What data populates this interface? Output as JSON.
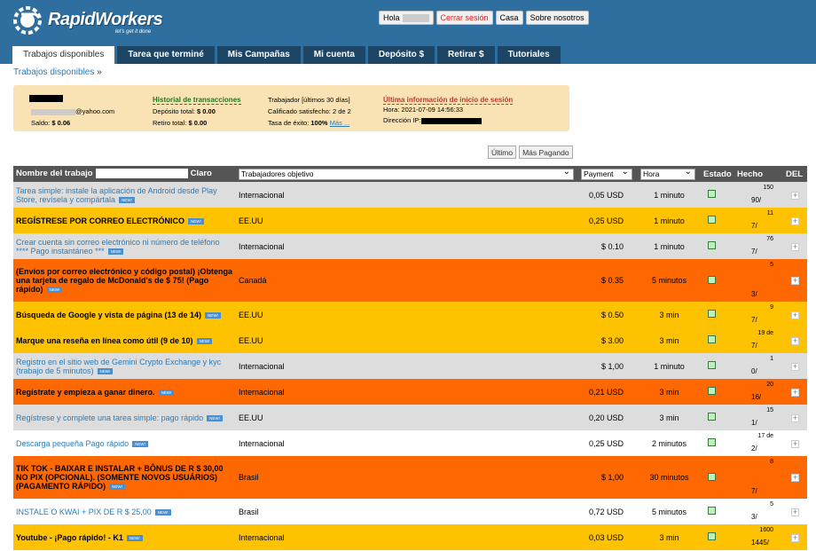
{
  "brand": {
    "name": "RapidWorkers",
    "tagline": "let's get it done"
  },
  "top": {
    "hello": "Hola",
    "logout": "Cerrar sesión",
    "home": "Casa",
    "about": "Sobre nosotros"
  },
  "tabs": [
    "Trabajos disponibles",
    "Tarea que terminé",
    "Mis Campañas",
    "Mi cuenta",
    "Depósito $",
    "Retirar $",
    "Tutoriales"
  ],
  "breadcrumb": {
    "label": "Trabajos disponibles",
    "arrow": "»"
  },
  "account": {
    "email_suffix": "@yahoo.com",
    "balance_label": "Saldo:",
    "balance": "$ 0.06",
    "history": "Historial de transacciones",
    "deposit_label": "Depósito total:",
    "deposit": "$ 0.00",
    "withdraw_label": "Retiro total:",
    "withdraw": "$ 0.00",
    "worker": "Trabajador [últimos 30 días]",
    "satisfied": "Calificado satisfecho: 2 de 2",
    "success_label": "Tasa de éxito:",
    "success": "100%",
    "more": "Más ...",
    "last_login": "Última información de inicio de sesión",
    "time": "Hora: 2021-07-09 14:56:33",
    "ip": "Dirección IP:"
  },
  "sort": {
    "latest": "Último",
    "top_paying": "Más Pagando"
  },
  "table": {
    "h_name": "Nombre del trabajo",
    "h_clear": "Claro",
    "h_target": "Trabajadores objetivo",
    "h_payment": "Payment",
    "h_hour": "Hora",
    "h_state": "Estado",
    "h_done": "Hecho",
    "h_del": "DEL",
    "new_badge": "NEW!",
    "rows": [
      {
        "name": "Tarea simple: instale la aplicación de Android desde Play Store, revísela y compártala",
        "color": "gray",
        "bold": false,
        "new": true,
        "target": "Internacional",
        "pay": "0,05 USD",
        "hour": "1 minuto",
        "total": "150",
        "done": "90/"
      },
      {
        "name": "REGÍSTRESE POR CORREO ELECTRÓNICO",
        "color": "yellow",
        "bold": true,
        "new": true,
        "target": "EE.UU",
        "pay": "0,25 USD",
        "hour": "1 minuto",
        "total": "11",
        "done": "7/"
      },
      {
        "name": "Crear cuenta sin correo electrónico ni número de teléfono **** Pago instantáneo ***",
        "color": "gray",
        "bold": false,
        "new": true,
        "target": "Internacional",
        "pay": "$ 0.10",
        "hour": "1 minuto",
        "total": "76",
        "done": "7/"
      },
      {
        "name": "(Envíos por correo electrónico y código postal) ¡Obtenga una tarjeta de regalo de McDonald's de $ 75! (Pago rápido)",
        "color": "orange",
        "bold": true,
        "new": true,
        "target": "Canadá",
        "pay": "$ 0.35",
        "hour": "5 minutos",
        "total": "5",
        "done": "3/"
      },
      {
        "name": "Búsqueda de Google y vista de página (13 de 14)",
        "color": "yellow",
        "bold": true,
        "new": true,
        "target": "EE.UU",
        "pay": "$ 0.50",
        "hour": "3 min",
        "total": "9",
        "done": "7/"
      },
      {
        "name": "Marque una reseña en línea como útil (9 de 10)",
        "color": "yellow",
        "bold": true,
        "new": true,
        "target": "EE.UU",
        "pay": "$ 3.00",
        "hour": "3 min",
        "total": "19 de",
        "done": "7/"
      },
      {
        "name": "Registro en el sitio web de Gemini Crypto Exchange y kyc (trabajo de 5 minutos)",
        "color": "gray",
        "bold": false,
        "new": true,
        "target": "Internacional",
        "pay": "$ 1,00",
        "hour": "1 minuto",
        "total": "1",
        "done": "0/"
      },
      {
        "name": "Regístrate y empieza a ganar dinero.",
        "color": "orange",
        "bold": true,
        "new": true,
        "target": "Internacional",
        "pay": "0,21 USD",
        "hour": "3 min",
        "total": "20",
        "done": "16/"
      },
      {
        "name": "Regístrese y complete una tarea simple: pago rápido",
        "color": "gray",
        "bold": false,
        "new": true,
        "target": "EE.UU",
        "pay": "0,20 USD",
        "hour": "3 min",
        "total": "15",
        "done": "1/"
      },
      {
        "name": "Descarga pequeña Pago rápido",
        "color": "white",
        "bold": false,
        "new": true,
        "target": "Internacional",
        "pay": "0,25 USD",
        "hour": "2 minutos",
        "total": "17 de",
        "done": "2/"
      },
      {
        "name": "TIK TOK - BAIXAR E INSTALAR + BÔNUS DE R $ 30,00 NO PIX (OPCIONAL). (SOMENTE NOVOS USUÁRIOS) (PAGAMENTO RÁPIDO)",
        "color": "orange",
        "bold": true,
        "new": true,
        "target": "Brasil",
        "pay": "$ 1,00",
        "hour": "30 minutos",
        "total": "8",
        "done": "7/"
      },
      {
        "name": "INSTALE O KWAI + PIX DE R $ 25,00",
        "color": "white",
        "bold": false,
        "new": true,
        "target": "Brasil",
        "pay": "0,72 USD",
        "hour": "5 minutos",
        "total": "5",
        "done": "3/"
      },
      {
        "name": "Youtube - ¡Pago rápido! - K1",
        "color": "yellow",
        "bold": true,
        "new": true,
        "target": "Internacional",
        "pay": "0,03 USD",
        "hour": "3 min",
        "total": "1600",
        "done": "1445/"
      }
    ]
  }
}
